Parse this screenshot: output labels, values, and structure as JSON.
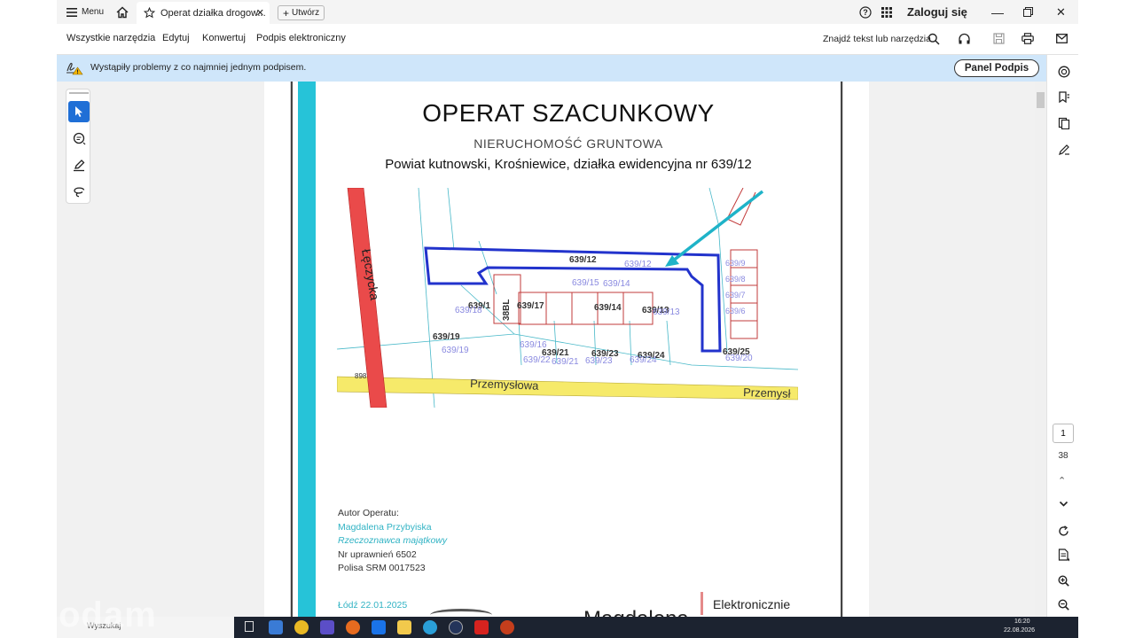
{
  "topbar": {
    "menu_label": "Menu",
    "tab_title": "Operat działka drogow...",
    "new_tab_label": "Utwórz",
    "login_label": "Zaloguj się"
  },
  "menubar": {
    "items": [
      "Wszystkie narzędzia",
      "Edytuj",
      "Konwertuj",
      "Podpis elektroniczny"
    ],
    "search_label": "Znajdź tekst lub narzędzia"
  },
  "banner": {
    "message": "Wystąpiły problemy z co najmniej jednym podpisem.",
    "button_label": "Panel Podpis"
  },
  "document": {
    "title": "OPERAT SZACUNKOWY",
    "subtitle": "NIERUCHOMOŚĆ GRUNTOWA",
    "location": "Powiat kutnowski, Krośniewice, działka ewidencyjna nr 639/12",
    "author_heading": "Autor Operatu:",
    "author_name": "Magdalena Przybyiska",
    "author_role": "Rzeczoznawca majątkowy",
    "license": "Nr uprawnień 6502",
    "policy": "Polisa  SRM 0017523",
    "place_date": "Łódź 22.01.2025",
    "signature_text": "Magdalena",
    "esign_label": "Elektronicznie"
  },
  "map": {
    "street_left": "Łęczycka",
    "street_bottom": "Przemysłowa",
    "street_bottom_right": "Przemysł",
    "road_number": "898",
    "parcels_bold": [
      "639/12",
      "639/1",
      "639/17",
      "639/14",
      "639/13",
      "639/19",
      "639/21",
      "639/23",
      "639/24",
      "639/25"
    ],
    "parcels_light": [
      "639/12",
      "639/15",
      "639/14",
      "639/18",
      "639/13",
      "639/19",
      "639/22",
      "639/21",
      "639/23",
      "639/24",
      "639/16",
      "639/20",
      "639/9",
      "639/8",
      "639/7",
      "639/6"
    ],
    "building_label": "38BL"
  },
  "pager": {
    "current": "1",
    "total": "38"
  },
  "taskbar": {
    "search_placeholder": "Wyszukaj",
    "time": "16:20",
    "date": "22.08.2026"
  },
  "watermark": "odam"
}
